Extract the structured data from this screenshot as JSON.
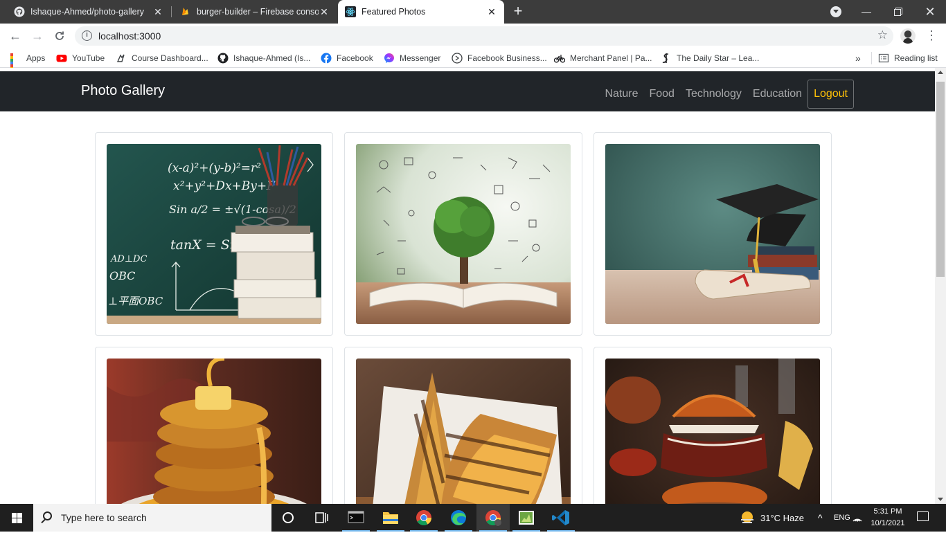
{
  "browser": {
    "tabs": [
      {
        "title": "Ishaque-Ahmed/photo-gallery",
        "icon": "github-icon",
        "active": false
      },
      {
        "title": "burger-builder – Firebase console",
        "icon": "firebase-icon",
        "active": false
      },
      {
        "title": "Featured Photos",
        "icon": "react-icon",
        "active": true
      }
    ],
    "new_tab": "+",
    "url": "localhost:3000",
    "bookmarks": [
      {
        "label": "Apps",
        "icon": "apps-grid-icon"
      },
      {
        "label": "YouTube",
        "icon": "youtube-icon"
      },
      {
        "label": "Course Dashboard...",
        "icon": "course-icon"
      },
      {
        "label": "Ishaque-Ahmed (Is...",
        "icon": "github-icon"
      },
      {
        "label": "Facebook",
        "icon": "facebook-icon"
      },
      {
        "label": "Messenger",
        "icon": "messenger-icon"
      },
      {
        "label": "Facebook Business...",
        "icon": "business-icon"
      },
      {
        "label": "Merchant Panel | Pa...",
        "icon": "bicycle-icon"
      },
      {
        "label": "The Daily Star – Lea...",
        "icon": "dailystar-icon"
      }
    ],
    "more_bookmarks": "»",
    "reading_list": "Reading list"
  },
  "app": {
    "brand": "Photo Gallery",
    "nav": [
      "Nature",
      "Food",
      "Technology",
      "Education"
    ],
    "logout": "Logout",
    "photos": [
      {
        "subject": "math-chalkboard-books"
      },
      {
        "subject": "tree-growing-from-book"
      },
      {
        "subject": "graduation-cap-diploma"
      },
      {
        "subject": "pancake-stack"
      },
      {
        "subject": "grilled-sandwich"
      },
      {
        "subject": "pulled-pork-burger"
      }
    ]
  },
  "taskbar": {
    "search_placeholder": "Type here to search",
    "weather": "31°C  Haze",
    "lang": "ENG",
    "time": "5:31 PM",
    "date": "10/1/2021"
  },
  "colors": {
    "navbar_bg": "#212529",
    "logout_text": "#ffc107",
    "tabstrip_bg": "#3c3c3c",
    "taskbar_bg": "#1f1f1f"
  }
}
